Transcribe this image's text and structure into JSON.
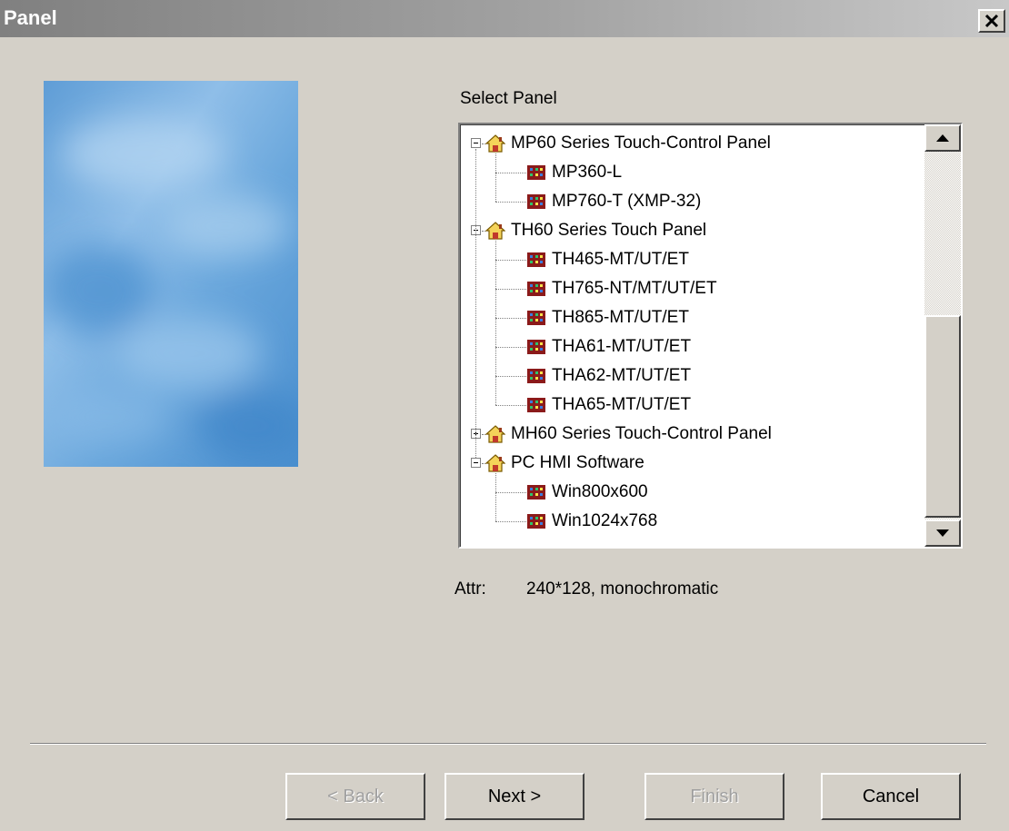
{
  "window": {
    "title": "Panel",
    "close_icon": "close-icon"
  },
  "select_label": "Select Panel",
  "tree": {
    "items": [
      {
        "label": "MP60 Series Touch-Control Panel",
        "type": "group",
        "expanded": true,
        "icon": "house-icon"
      },
      {
        "label": "MP360-L",
        "type": "panel",
        "icon": "panel-icon"
      },
      {
        "label": "MP760-T (XMP-32)",
        "type": "panel",
        "icon": "panel-icon"
      },
      {
        "label": "TH60 Series Touch Panel",
        "type": "group",
        "expanded": true,
        "icon": "house-icon"
      },
      {
        "label": "TH465-MT/UT/ET",
        "type": "panel",
        "icon": "panel-icon"
      },
      {
        "label": "TH765-NT/MT/UT/ET",
        "type": "panel",
        "icon": "panel-icon"
      },
      {
        "label": "TH865-MT/UT/ET",
        "type": "panel",
        "icon": "panel-icon"
      },
      {
        "label": "THA61-MT/UT/ET",
        "type": "panel",
        "icon": "panel-icon"
      },
      {
        "label": "THA62-MT/UT/ET",
        "type": "panel",
        "icon": "panel-icon"
      },
      {
        "label": "THA65-MT/UT/ET",
        "type": "panel",
        "icon": "panel-icon"
      },
      {
        "label": "MH60 Series Touch-Control Panel",
        "type": "group",
        "expanded": false,
        "icon": "house-icon"
      },
      {
        "label": "PC HMI Software",
        "type": "group",
        "expanded": true,
        "icon": "house-icon"
      },
      {
        "label": "Win800x600",
        "type": "panel",
        "icon": "panel-icon"
      },
      {
        "label": "Win1024x768",
        "type": "panel",
        "icon": "panel-icon"
      }
    ]
  },
  "attr": {
    "label": "Attr:",
    "value": "240*128, monochromatic"
  },
  "buttons": {
    "back": "< Back",
    "next": "Next >",
    "finish": "Finish",
    "cancel": "Cancel"
  },
  "colors": {
    "dialog_bg": "#d4d0c8",
    "title_gradient_start": "#808080",
    "title_gradient_end": "#c8c8c8",
    "disabled_text": "#a0a0a0"
  }
}
